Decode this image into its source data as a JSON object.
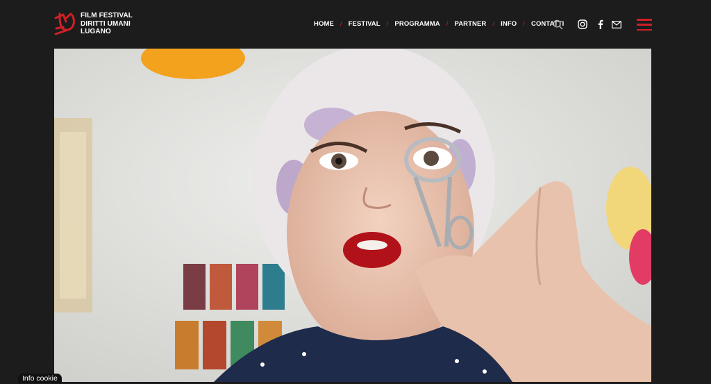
{
  "header": {
    "logo": {
      "line1": "FILM FESTIVAL",
      "line2": "DIRITTI UMANI",
      "line3": "LUGANO",
      "mark_color": "#d21f26"
    },
    "nav": [
      {
        "label": "HOME"
      },
      {
        "label": "FESTIVAL"
      },
      {
        "label": "PROGRAMMA"
      },
      {
        "label": "PARTNER"
      },
      {
        "label": "INFO"
      },
      {
        "label": "CONTATTI"
      }
    ],
    "nav_separator": "/",
    "icons": [
      "search-icon",
      "instagram-icon",
      "facebook-icon",
      "mail-icon",
      "hamburger-menu-icon"
    ]
  },
  "hero": {
    "image": "photo of a child with red lipstick and towel on head holding an eyelash curler"
  },
  "cookie": {
    "label": "Info cookie"
  },
  "colors": {
    "background": "#1c1c1c",
    "accent": "#d21f26"
  }
}
